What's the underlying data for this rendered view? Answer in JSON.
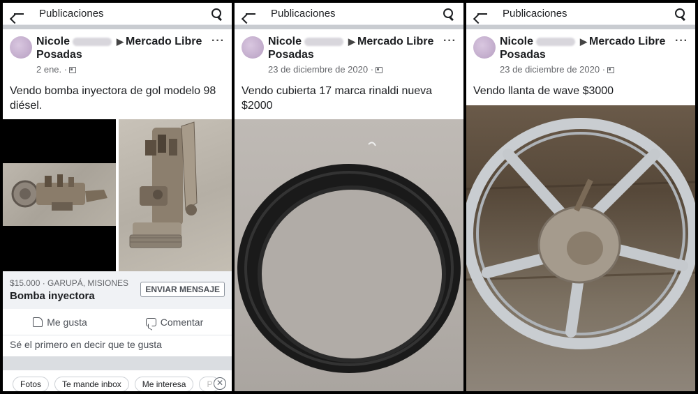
{
  "topbar": {
    "title": "Publicaciones"
  },
  "posts": [
    {
      "author_first": "Nicole",
      "author_group": "Mercado Libre Posadas",
      "date": "2 ene. ·",
      "text": "Vendo bomba inyectora de gol modelo 98 diésel.",
      "listing": {
        "meta": "$15.000 · GARUPÁ, MISIONES",
        "title": "Bomba inyectora",
        "button": "ENVIAR MENSAJE"
      },
      "actions": {
        "like": "Me gusta",
        "comment": "Comentar"
      },
      "first_like": "Sé el primero en decir que te gusta",
      "chips": [
        "Fotos",
        "Te mande inbox",
        "Me interesa",
        "P"
      ]
    },
    {
      "author_first": "Nicole",
      "author_group": "Mercado Libre Posadas",
      "date": "23 de diciembre de 2020 ·",
      "text": "Vendo cubierta 17 marca rinaldi nueva $2000"
    },
    {
      "author_first": "Nicole",
      "author_group": "Mercado Libre Posadas",
      "date": "23 de diciembre de 2020 ·",
      "text": "Vendo llanta de wave $3000"
    }
  ],
  "icons": {
    "back": "back-arrow-icon",
    "search": "search-icon",
    "more": "more-options-icon",
    "privacy": "group-privacy-icon",
    "like": "like-icon",
    "comment": "comment-icon",
    "close": "close-icon"
  }
}
